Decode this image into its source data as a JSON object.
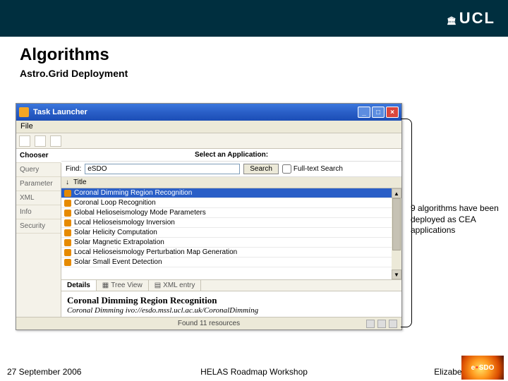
{
  "banner": {
    "ucl_small": "🏛",
    "ucl_text": "UCL"
  },
  "title": "Algorithms",
  "subtitle": "Astro.Grid Deployment",
  "window": {
    "title": "Task Launcher",
    "menu_file": "File",
    "sidebar": {
      "items": [
        {
          "label": "Chooser",
          "active": true
        },
        {
          "label": "Query"
        },
        {
          "label": "Parameter"
        },
        {
          "label": "XML"
        },
        {
          "label": "Info"
        },
        {
          "label": "Security"
        }
      ]
    },
    "heading": "Select an Application:",
    "find_label": "Find:",
    "find_value": "eSDO",
    "search_label": "Search",
    "fulltext_label": "Full-text Search",
    "sort_label": "↓",
    "col_title": "Title",
    "rows": [
      "Coronal Dimming Region Recognition",
      "Coronal Loop Recognition",
      "Global Helioseismology Mode Parameters",
      "Local Helioseismology Inversion",
      "Solar Helicity Computation",
      "Solar Magnetic Extrapolation",
      "Local Helioseismology Perturbation Map Generation",
      "Solar Small Event Detection"
    ],
    "dtabs": {
      "details": "Details",
      "tree": "Tree View",
      "xml": "XML entry"
    },
    "detail_title": "Coronal Dimming Region Recognition",
    "detail_body": "Coronal Dimming  ivo://esdo.mssl.ucl.ac.uk/CoronalDimming",
    "status": "Found 11 resources"
  },
  "annotation": "9 algorithms have been deployed as CEA applications",
  "footer": {
    "date": "27 September 2006",
    "center": "HELAS Roadmap Workshop",
    "right": "Elizabeth Auden"
  },
  "esdo": {
    "e": "e",
    "sdo": "SDO"
  }
}
